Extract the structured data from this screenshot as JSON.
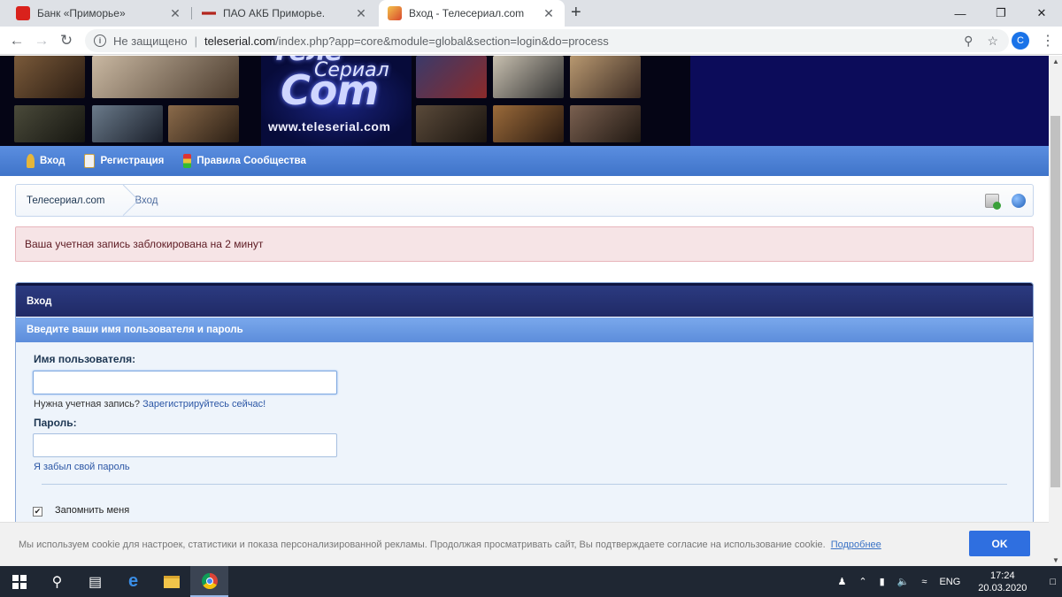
{
  "browser": {
    "tabs": [
      {
        "title": "Банк «Приморье»",
        "favicon_color": "#d9221c"
      },
      {
        "title": "ПАО АКБ Приморье.",
        "favicon_color": "#b3261e"
      },
      {
        "title": "Вход - Телесериал.com",
        "favicon_color": "#e8a23a",
        "active": true
      }
    ],
    "new_tab": "+",
    "window_controls": {
      "minimize": "—",
      "maximize": "❐",
      "close": "✕"
    },
    "security_label": "Не защищено",
    "address_separator": "|",
    "url_host": "teleserial.com",
    "url_path": "/index.php?app=core&module=global&section=login&do=process",
    "profile_initial": "C"
  },
  "site": {
    "banner": {
      "logo_line1": "Теле",
      "logo_line2": "Сериал",
      "logo_line3": "Com",
      "logo_url": "www.teleserial.com"
    },
    "nav": [
      {
        "label": "Вход",
        "icon": "key-icon",
        "color": "#e6b63a"
      },
      {
        "label": "Регистрация",
        "icon": "clipboard-icon",
        "color": "#f2f2f2"
      },
      {
        "label": "Правила Сообщества",
        "icon": "traffic-light-icon",
        "color": "#3b3b3b"
      }
    ],
    "breadcrumb": {
      "home": "Телесериал.com",
      "current": "Вход"
    },
    "error_message": "Ваша учетная запись заблокирована на 2 минут",
    "login": {
      "title": "Вход",
      "subtitle": "Введите ваши имя пользователя и пароль",
      "username_label": "Имя пользователя:",
      "username_value": "",
      "need_account": "Нужна учетная запись?",
      "register_link": "Зарегистрируйтесь сейчас!",
      "password_label": "Пароль:",
      "password_value": "",
      "forgot_link": "Я забыл свой пароль",
      "remember_label": "Запомнить меня",
      "remember_checked": true,
      "check_mark": "✔"
    },
    "cookie": {
      "text": "Мы используем cookie для настроек, статистики и показа персонализированной рекламы. Продолжая просматривать сайт, Вы подтверждаете согласие на использование cookie.",
      "more_link": "Подробнее",
      "ok_button": "OK"
    }
  },
  "taskbar": {
    "language": "ENG",
    "time": "17:24",
    "date": "20.03.2020"
  }
}
